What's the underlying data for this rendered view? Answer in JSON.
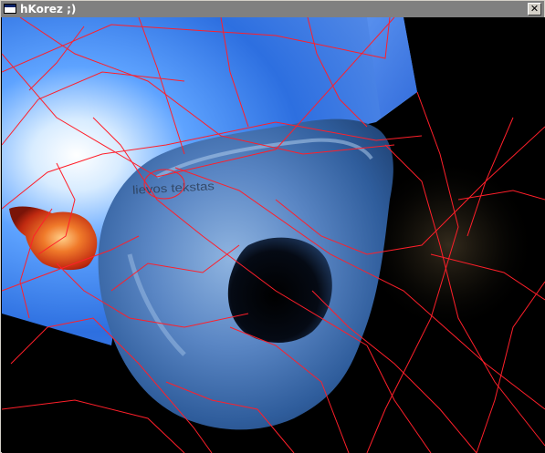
{
  "window": {
    "title": "hKorez ;)",
    "close_glyph": "✕"
  },
  "scene": {
    "engraved_text": "lievos tekstas",
    "colors": {
      "background": "#000000",
      "sky_plane": "#3b7be0",
      "torus": "#3d6fb3",
      "wireframe": "#ff1f2a",
      "teapot": "#e8501a"
    }
  }
}
